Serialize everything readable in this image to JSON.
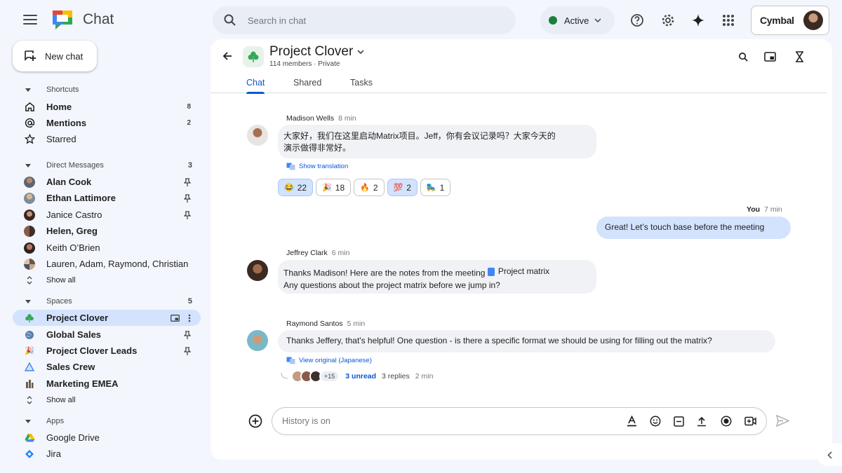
{
  "header": {
    "app_title": "Chat",
    "search_placeholder": "Search in chat",
    "status_label": "Active",
    "brand": "Cymbal",
    "colors": {
      "active_dot": "#188038",
      "accent": "#0b57d0"
    }
  },
  "sidebar": {
    "new_chat_label": "New chat",
    "shortcuts": {
      "title": "Shortcuts",
      "items": [
        {
          "label": "Home",
          "count": "8",
          "icon": "home-icon"
        },
        {
          "label": "Mentions",
          "count": "2",
          "icon": "at-icon"
        },
        {
          "label": "Starred",
          "count": "",
          "icon": "star-icon"
        }
      ]
    },
    "direct_messages": {
      "title": "Direct Messages",
      "count": "3",
      "items": [
        {
          "label": "Alan Cook",
          "bold": true,
          "pinned": true
        },
        {
          "label": "Ethan Lattimore",
          "bold": true,
          "pinned": true
        },
        {
          "label": "Janice Castro",
          "bold": false,
          "pinned": true
        },
        {
          "label": "Helen, Greg",
          "bold": true,
          "pinned": false
        },
        {
          "label": "Keith O’Brien",
          "bold": false,
          "pinned": false
        },
        {
          "label": "Lauren, Adam, Raymond, Christian",
          "bold": false,
          "pinned": false
        }
      ],
      "show_all": "Show all"
    },
    "spaces": {
      "title": "Spaces",
      "count": "5",
      "items": [
        {
          "label": "Project Clover",
          "bold": true,
          "active": true
        },
        {
          "label": "Global Sales",
          "bold": true,
          "pinned": true
        },
        {
          "label": "Project Clover Leads",
          "bold": true,
          "pinned": true
        },
        {
          "label": "Sales Crew",
          "bold": true
        },
        {
          "label": "Marketing EMEA",
          "bold": true
        }
      ],
      "show_all": "Show all"
    },
    "apps": {
      "title": "Apps",
      "items": [
        {
          "label": "Google Drive"
        },
        {
          "label": "Jira"
        }
      ]
    }
  },
  "space": {
    "title": "Project Clover",
    "subtitle": "114 members · Private",
    "tabs": [
      "Chat",
      "Shared",
      "Tasks"
    ],
    "active_tab": "Chat"
  },
  "messages": [
    {
      "author": "Madison Wells",
      "time": "8 min",
      "line1": "大家好，我们在这里启动Matrix项目。Jeff，你有会议记录吗？大家今天的",
      "line2": "演示做得非常好。",
      "link": "Show translation",
      "reactions": [
        {
          "emoji": "😂",
          "count": "22",
          "selected": true
        },
        {
          "emoji": "🎉",
          "count": "18",
          "selected": false
        },
        {
          "emoji": "🔥",
          "count": "2",
          "selected": false
        },
        {
          "emoji": "💯",
          "count": "2",
          "selected": true
        },
        {
          "emoji": "🛼",
          "count": "1",
          "selected": false
        }
      ]
    },
    {
      "author": "You",
      "time": "7 min",
      "text": "Great! Let’s touch base before the meeting"
    },
    {
      "author": "Jeffrey Clark",
      "time": "6 min",
      "line1": "Thanks Madison!  Here are the notes from the meeting",
      "chip": "Project matrix",
      "line2": "Any questions about the project matrix before we jump in?"
    },
    {
      "author": "Raymond Santos",
      "time": "5 min",
      "text": "Thanks Jeffery, that's helpful!  One question -  is there a specific format we should be using for filling out the matrix?",
      "link": "View original (Japanese)",
      "thread": {
        "more": "+15",
        "unread": "3 unread",
        "replies": "3 replies",
        "time": "2 min"
      }
    }
  ],
  "composer": {
    "placeholder": "History is on"
  }
}
